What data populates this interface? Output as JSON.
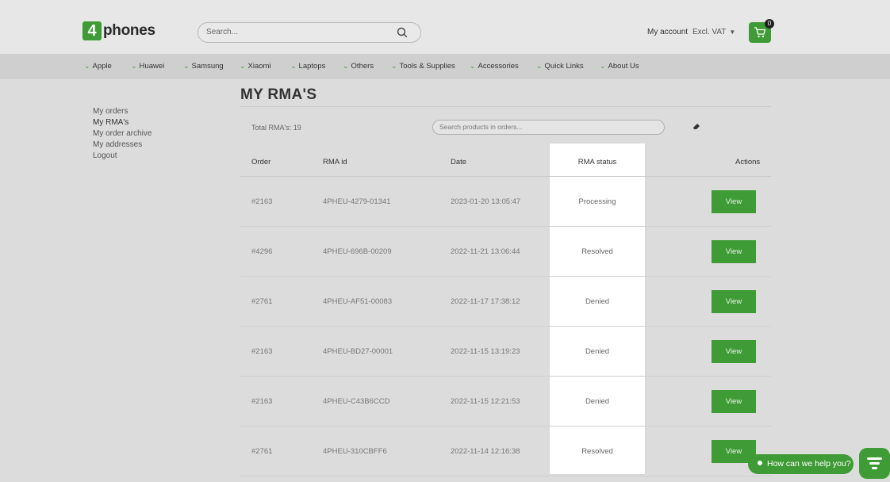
{
  "header": {
    "logo_mark": "4",
    "logo_text": "phones",
    "search_placeholder": "Search...",
    "my_account": "My account",
    "vat_label": "Excl. VAT",
    "cart_count": "0",
    "brand_color": "#3f9b35"
  },
  "nav": {
    "items": [
      {
        "label": "Apple"
      },
      {
        "label": "Huawei"
      },
      {
        "label": "Samsung"
      },
      {
        "label": "Xiaomi"
      },
      {
        "label": "Laptops"
      },
      {
        "label": "Others"
      },
      {
        "label": "Tools & Supplies"
      },
      {
        "label": "Accessories"
      },
      {
        "label": "Quick Links"
      },
      {
        "label": "About Us"
      }
    ]
  },
  "sidebar": {
    "items": [
      {
        "label": "My orders"
      },
      {
        "label": "My RMA's"
      },
      {
        "label": "My order archive"
      },
      {
        "label": "My addresses"
      },
      {
        "label": "Logout"
      }
    ]
  },
  "main": {
    "title": "MY RMA'S",
    "total": "Total RMA's: 19",
    "search_placeholder": "Search products in orders...",
    "columns": [
      "Order",
      "RMA id",
      "Date",
      "RMA status",
      "Actions"
    ],
    "rows": [
      {
        "order": "#2163",
        "rma_id": "4PHEU-4279-01341",
        "date": "2023-01-20 13:05:47",
        "status": "Processing",
        "action": "View"
      },
      {
        "order": "#4296",
        "rma_id": "4PHEU-696B-00209",
        "date": "2022-11-21 13:06:44",
        "status": "Resolved",
        "action": "View"
      },
      {
        "order": "#2761",
        "rma_id": "4PHEU-AF51-00083",
        "date": "2022-11-17 17:38:12",
        "status": "Denied",
        "action": "View"
      },
      {
        "order": "#2163",
        "rma_id": "4PHEU-BD27-00001",
        "date": "2022-11-15 13:19:23",
        "status": "Denied",
        "action": "View"
      },
      {
        "order": "#2163",
        "rma_id": "4PHEU-C43B6CCD",
        "date": "2022-11-15 12:21:53",
        "status": "Denied",
        "action": "View"
      },
      {
        "order": "#2761",
        "rma_id": "4PHEU-310CBFF6",
        "date": "2022-11-14 12:16:38",
        "status": "Resolved",
        "action": "View"
      }
    ]
  },
  "chat": {
    "label": "How can we help you?"
  }
}
